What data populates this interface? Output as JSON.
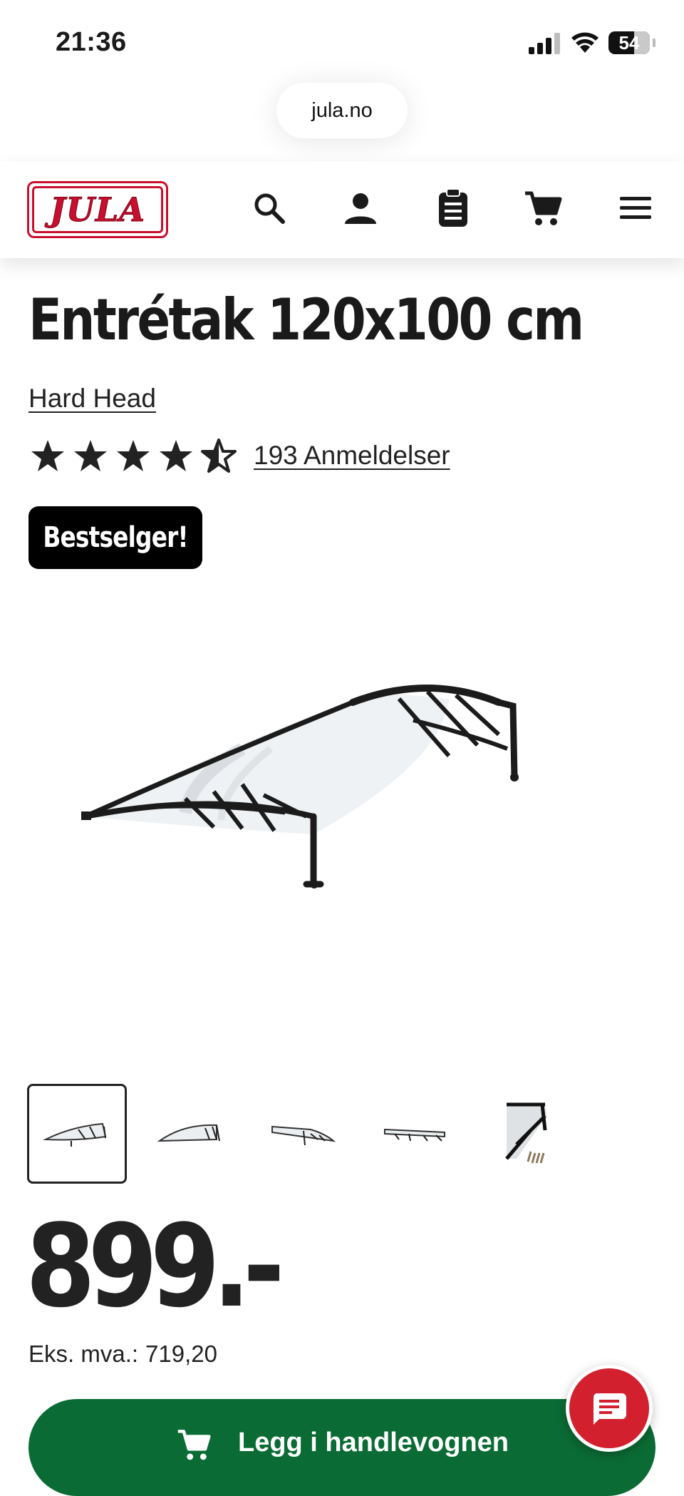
{
  "status_bar": {
    "time": "21:36",
    "battery": "54"
  },
  "browser": {
    "url": "jula.no"
  },
  "header": {
    "logo_text": "JULA",
    "icons": [
      "search-icon",
      "account-icon",
      "clipboard-icon",
      "cart-icon",
      "menu-icon"
    ]
  },
  "product": {
    "title": "Entrétak 120x100 cm",
    "brand": "Hard Head",
    "rating": 4.5,
    "rating_max": 5,
    "reviews_label": "193 Anmeldelser",
    "badge": "Bestselger!",
    "price": "899.-",
    "price_ex_vat_label": "Eks. mva.:",
    "price_ex_vat_value": "719,20",
    "thumbnail_count": 5,
    "selected_thumbnail": 1
  },
  "actions": {
    "add_to_cart": "Legg i handlevognen"
  },
  "colors": {
    "brand_red": "#c8102e",
    "cart_green": "#0b6b34",
    "chat_red": "#d2202f"
  }
}
